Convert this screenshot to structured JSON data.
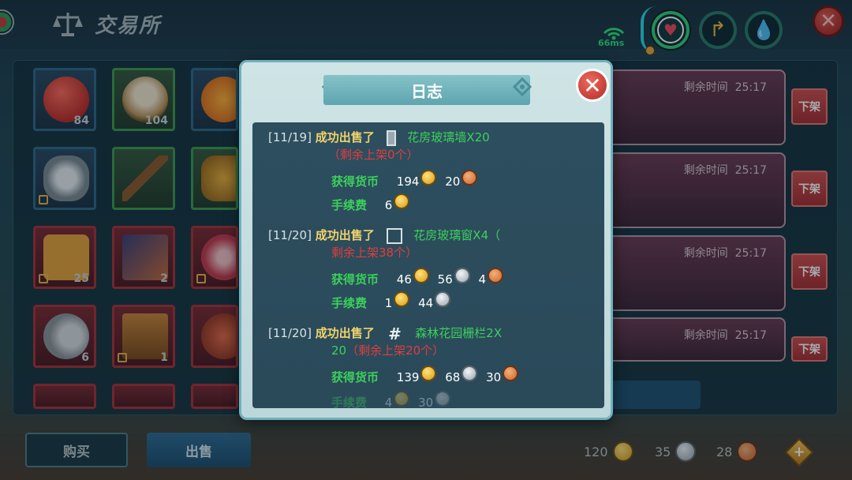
{
  "header": {
    "title": "交易所",
    "ping": "66ms"
  },
  "inventory": [
    {
      "name": "apple",
      "count": "84",
      "tone": "blue"
    },
    {
      "name": "dumplings",
      "count": "104",
      "tone": "green"
    },
    {
      "name": "flower",
      "count": "",
      "tone": "blue"
    },
    {
      "name": "stone",
      "count": "",
      "tone": "blue"
    },
    {
      "name": "axe",
      "count": "",
      "tone": "green"
    },
    {
      "name": "boot",
      "count": "",
      "tone": "green"
    },
    {
      "name": "shirt",
      "count": "25",
      "tone": "red"
    },
    {
      "name": "card",
      "count": "2",
      "tone": "red"
    },
    {
      "name": "blossom",
      "count": "",
      "tone": "red"
    },
    {
      "name": "horn",
      "count": "6",
      "tone": "red"
    },
    {
      "name": "banner",
      "count": "1",
      "tone": "red"
    },
    {
      "name": "crab",
      "count": "",
      "tone": "red"
    }
  ],
  "listings": [
    {
      "time_label": "剩余时间",
      "time": "25:17",
      "button": "下架"
    },
    {
      "time_label": "剩余时间",
      "time": "25:17",
      "button": "下架"
    },
    {
      "time_label": "剩余时间",
      "time": "25:17",
      "button": "下架"
    },
    {
      "time_label": "剩余时间",
      "time": "25:17",
      "button": "下架"
    }
  ],
  "bottom": {
    "buy": "购买",
    "sell": "出售",
    "wallet": {
      "gold": "120",
      "silver": "35",
      "copper": "28"
    }
  },
  "log": {
    "title": "日志",
    "close": "✕",
    "entries": [
      {
        "date": "[11/19]",
        "action": "成功出售了",
        "item": "花房玻璃墙X20",
        "remain": "（剩余上架0个）",
        "income_label": "获得货币",
        "income": [
          {
            "type": "gold",
            "value": "194"
          },
          {
            "type": "copper",
            "value": "20"
          }
        ],
        "fee_label": "手续费",
        "fee": [
          {
            "type": "gold",
            "value": "6"
          }
        ]
      },
      {
        "date": "[11/20]",
        "action": "成功出售了",
        "item": "花房玻璃窗X4（",
        "remain": "剩余上架38个）",
        "income_label": "获得货币",
        "income": [
          {
            "type": "gold",
            "value": "46"
          },
          {
            "type": "silver",
            "value": "56"
          },
          {
            "type": "copper",
            "value": "4"
          }
        ],
        "fee_label": "手续费",
        "fee": [
          {
            "type": "gold",
            "value": "1"
          },
          {
            "type": "silver",
            "value": "44"
          }
        ]
      },
      {
        "date": "[11/20]",
        "action": "成功出售了",
        "item": "森林花园栅栏2X",
        "remain_prefix": "20",
        "remain": "（剩余上架20个）",
        "income_label": "获得货币",
        "income": [
          {
            "type": "gold",
            "value": "139"
          },
          {
            "type": "silver",
            "value": "68"
          },
          {
            "type": "copper",
            "value": "30"
          }
        ],
        "fee_label": "手续费",
        "fee": [
          {
            "type": "gold",
            "value": "4"
          },
          {
            "type": "silver",
            "value": "30"
          }
        ]
      }
    ]
  },
  "colors": {
    "accent": "#6fb1bd",
    "income_label": "#3cd05b",
    "warning": "#e23d3d",
    "action": "#f1d36c"
  }
}
